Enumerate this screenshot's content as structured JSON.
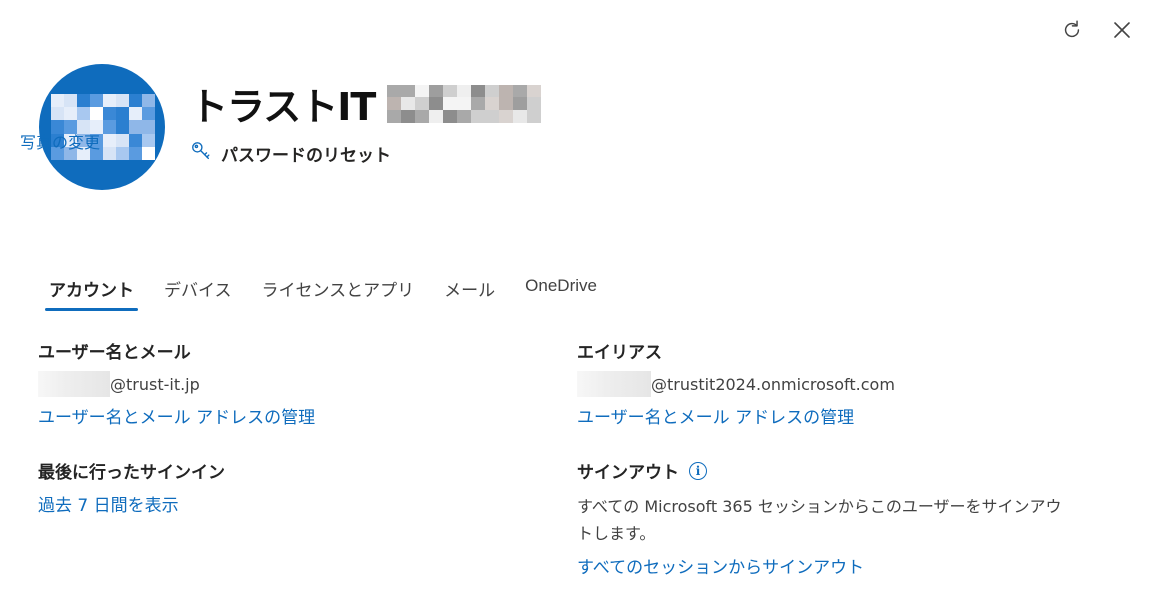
{
  "header": {
    "user_display_name": "トラストIT",
    "change_photo_label": "写真の変更",
    "reset_password_label": "パスワードのリセット"
  },
  "tabs": [
    {
      "label": "アカウント",
      "active": true
    },
    {
      "label": "デバイス",
      "active": false
    },
    {
      "label": "ライセンスとアプリ",
      "active": false
    },
    {
      "label": "メール",
      "active": false
    },
    {
      "label": "OneDrive",
      "active": false
    }
  ],
  "account": {
    "username_email": {
      "title": "ユーザー名とメール",
      "value_suffix": "@trust-it.jp",
      "manage_link": "ユーザー名とメール アドレスの管理"
    },
    "alias": {
      "title": "エイリアス",
      "value_suffix": "@trustit2024.onmicrosoft.com",
      "manage_link": "ユーザー名とメール アドレスの管理"
    },
    "last_signin": {
      "title": "最後に行ったサインイン",
      "link": "過去 7 日間を表示"
    },
    "signout": {
      "title": "サインアウト",
      "info_icon": "i",
      "description": "すべての Microsoft 365 セッションからこのユーザーをサインアウトします。",
      "link": "すべてのセッションからサインアウト"
    }
  },
  "icons": {
    "refresh": "refresh-icon",
    "close": "close-icon",
    "key": "key-icon",
    "info": "info-icon"
  },
  "colors": {
    "accent": "#0f6cbd",
    "avatar_bg": "#0f6cbd"
  }
}
